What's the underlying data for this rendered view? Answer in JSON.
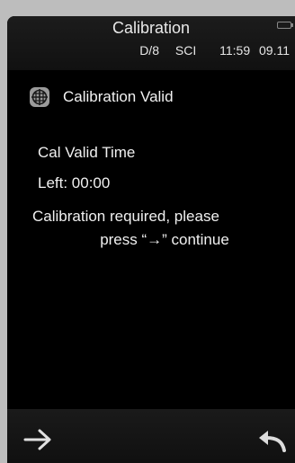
{
  "header": {
    "title": "Calibration",
    "geometry": "D/8",
    "mode": "SCI",
    "time": "11:59",
    "date": "09.11",
    "battery_icon": "battery-icon"
  },
  "status": {
    "icon": "calibration-target-icon",
    "label": "Calibration Valid"
  },
  "info": {
    "valid_time_label": "Cal Valid Time",
    "time_left": "Left: 00:00"
  },
  "message": {
    "line1": "Calibration required, please",
    "line2": "press “→” continue"
  },
  "footer": {
    "next_icon": "arrow-right-icon",
    "back_icon": "return-icon"
  },
  "colors": {
    "background": "#000000",
    "bar": "#141414",
    "text": "#f0f0f0"
  }
}
